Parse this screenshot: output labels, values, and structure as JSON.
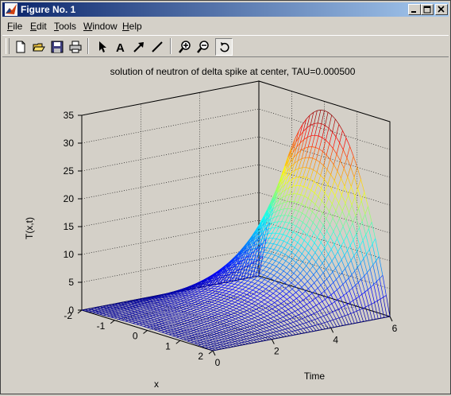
{
  "window": {
    "title": "Figure No. 1",
    "titlebar_gradient_start": "#0a246a",
    "titlebar_gradient_end": "#a6caf0",
    "controls": [
      "minimize-icon",
      "maximize-icon",
      "close-icon"
    ]
  },
  "menu": {
    "items": [
      {
        "label": "File",
        "accel": "F",
        "rest": "ile"
      },
      {
        "label": "Edit",
        "accel": "E",
        "rest": "dit"
      },
      {
        "label": "Tools",
        "accel": "T",
        "rest": "ools"
      },
      {
        "label": "Window",
        "accel": "W",
        "rest": "indow"
      },
      {
        "label": "Help",
        "accel": "H",
        "rest": "elp"
      }
    ]
  },
  "toolbar": {
    "buttons": [
      "new-figure-icon",
      "open-file-icon",
      "save-icon",
      "print-icon",
      "edit-plot-arrow-icon",
      "insert-text-icon",
      "insert-arrow-icon",
      "insert-line-icon",
      "zoom-in-icon",
      "zoom-out-icon",
      "rotate-3d-icon"
    ],
    "active": "rotate-3d-icon"
  },
  "chart_data": {
    "type": "surface",
    "title": "solution of neutron of delta spike at center, TAU=0.000500",
    "xlabel": "x",
    "ylabel": "Time",
    "zlabel": "T(x,t)",
    "x_ticks": [
      "-2",
      "-1",
      "0",
      "1",
      "2"
    ],
    "time_ticks": [
      "0",
      "2",
      "4",
      "6"
    ],
    "z_ticks": [
      "0",
      "5",
      "10",
      "15",
      "20",
      "25",
      "30",
      "35"
    ],
    "xlim": [
      -2,
      2
    ],
    "time_lim": [
      0,
      6
    ],
    "zlim": [
      0,
      35
    ],
    "grid": true,
    "colormap": "jet",
    "colormap_colors": [
      "#00008f",
      "#0000ff",
      "#00ffff",
      "#ffff00",
      "#ff0000",
      "#800000"
    ],
    "surface_model": "z = 0.5*(1-(x/2)^2)*exp(0.7*t), wireframe over x in [-2,2], t in [0,6]",
    "peak_z": 33,
    "background": "#d4d0c8",
    "axes_color": "#000000"
  }
}
